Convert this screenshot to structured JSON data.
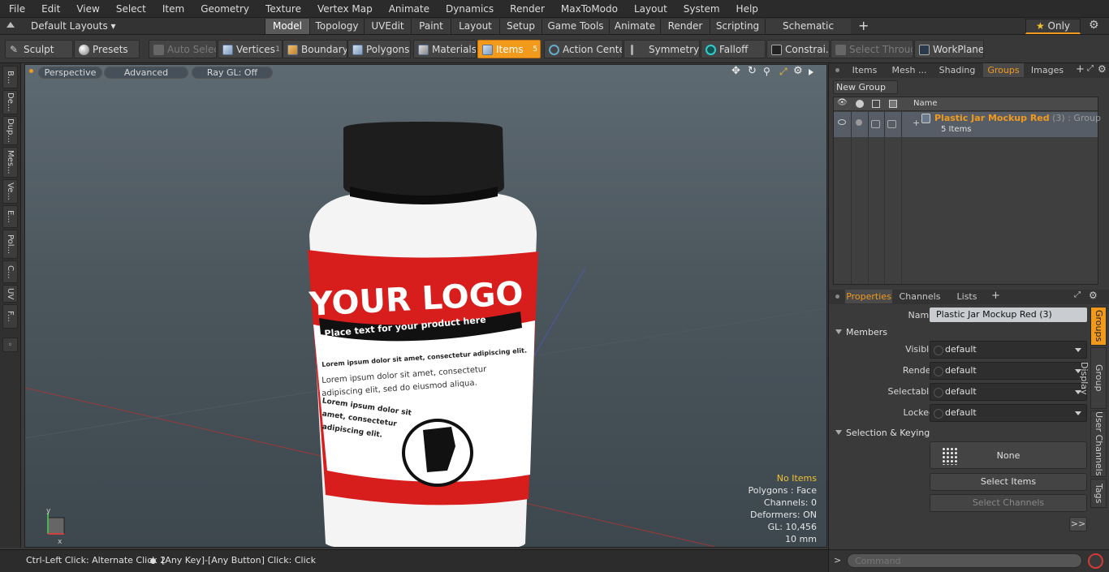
{
  "menu": [
    "File",
    "Edit",
    "View",
    "Select",
    "Item",
    "Geometry",
    "Texture",
    "Vertex Map",
    "Animate",
    "Dynamics",
    "Render",
    "MaxToModo",
    "Layout",
    "System",
    "Help"
  ],
  "layout_selector": "Default Layouts",
  "layout_tabs": [
    "Model",
    "Topology",
    "UVEdit",
    "Paint",
    "Layout",
    "Setup",
    "Game Tools",
    "Animate",
    "Render",
    "Scripting",
    "Schematic Fusion"
  ],
  "only_label": "Only",
  "toolbar": {
    "sculpt": "Sculpt",
    "presets": "Presets",
    "auto_select": "Auto Select",
    "vertices": "Vertices",
    "vertices_count": "1",
    "boundary": "Boundary",
    "polygons": "Polygons",
    "materials": "Materials",
    "items": "Items",
    "items_count": "5",
    "action_center": "Action Center",
    "symmetry": "Symmetry",
    "falloff": "Falloff",
    "constraints": "Constrai...",
    "select_through": "Select Through",
    "workplane": "WorkPlane"
  },
  "left_tabs": [
    "B...",
    "De...",
    "Dup...",
    "Mes...",
    "Ve...",
    "E...",
    "Pol...",
    "C...",
    "UV",
    "F..."
  ],
  "viewport": {
    "perspective": "Perspective",
    "advanced": "Advanced",
    "raygl": "Ray GL: Off",
    "info": {
      "no_items": "No Items",
      "polygons": "Polygons : Face",
      "channels": "Channels: 0",
      "deformers": "Deformers: ON",
      "gl": "GL: 10,456",
      "scale": "10 mm"
    },
    "jar": {
      "logo": "YOUR LOGO",
      "tagline": "Place text for your product here",
      "line1": "Lorem ipsum dolor sit amet, consectetur adipiscing elit.",
      "line2": "Lorem ipsum dolor sit amet, consectetur",
      "line3": "adipiscing elit, sed do eiusmod aliqua.",
      "line4": "Lorem ipsum dolor sit",
      "line5": "amet, consectetur",
      "line6": "adipiscing elit."
    }
  },
  "status": {
    "hint1": "Ctrl-Left Click: Alternate Click 2",
    "hint2": "[Any Key]-[Any Button] Click: Click"
  },
  "right_top": {
    "tabs": [
      "Items",
      "Mesh ...",
      "Shading",
      "Groups",
      "Images"
    ],
    "active": "Groups",
    "new_group": "New Group",
    "col_name": "Name",
    "group_name": "Plastic Jar Mockup Red",
    "group_count": "(3)",
    "group_type": ": Group",
    "group_items": "5 Items"
  },
  "right_bottom": {
    "tabs": [
      "Properties",
      "Channels",
      "Lists"
    ],
    "name_label": "Name",
    "name_value": "Plastic Jar Mockup Red (3)",
    "members": "Members",
    "rows": [
      {
        "label": "Visible",
        "value": "default"
      },
      {
        "label": "Render",
        "value": "default"
      },
      {
        "label": "Selectable",
        "value": "default"
      },
      {
        "label": "Locked",
        "value": "default"
      }
    ],
    "selection_keying": "Selection & Keying",
    "none": "None",
    "select_items": "Select Items",
    "select_channels": "Select Channels",
    "side_tabs": [
      "Groups",
      "Group Display",
      "User Channels",
      "Tags"
    ],
    "more": ">>"
  },
  "command_placeholder": "Command"
}
